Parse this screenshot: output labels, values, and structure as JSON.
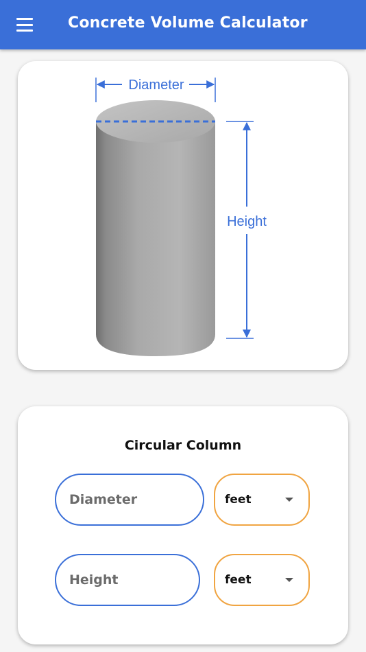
{
  "app_bar": {
    "title": "Concrete Volume Calculator",
    "background": "#3a6fd8",
    "menu_icon": "hamburger-menu-icon"
  },
  "diagram": {
    "diameter_label": "Diameter",
    "height_label": "Height",
    "annotation_color": "#3a6fd8"
  },
  "form": {
    "title": "Circular Column",
    "rows": [
      {
        "placeholder": "Diameter",
        "unit": "feet"
      },
      {
        "placeholder": "Height",
        "unit": "feet"
      }
    ],
    "input_border_color": "#3a6fd8",
    "select_border_color": "#f0a441"
  }
}
